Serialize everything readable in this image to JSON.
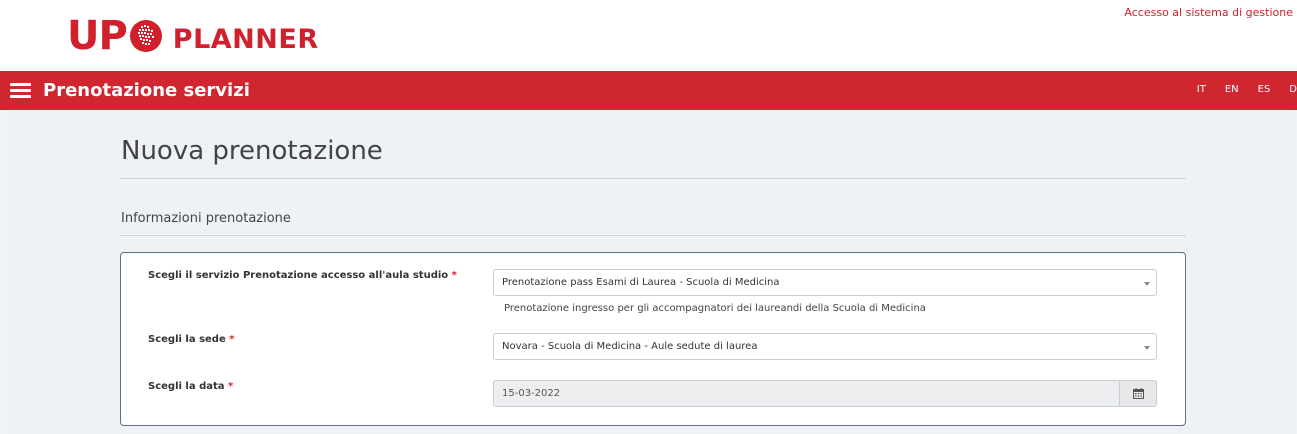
{
  "header": {
    "logo_up": "UP",
    "logo_planner": "PLANNER",
    "admin_link": "Accesso al sistema di gestione"
  },
  "navbar": {
    "title": "Prenotazione servizi",
    "languages": [
      "IT",
      "EN",
      "ES",
      "D"
    ]
  },
  "page": {
    "title": "Nuova prenotazione",
    "section_title": "Informazioni prenotazione"
  },
  "form": {
    "service": {
      "label": "Scegli il servizio Prenotazione accesso all'aula studio",
      "required_mark": "*",
      "value": "Prenotazione pass Esami di Laurea - Scuola di Medicina",
      "help": "Prenotazione ingresso per gli accompagnatori dei laureandi della Scuola di Medicina"
    },
    "site": {
      "label": "Scegli la sede",
      "required_mark": "*",
      "value": "Novara - Scuola di Medicina - Aule sedute di laurea"
    },
    "date": {
      "label": "Scegli la data",
      "required_mark": "*",
      "value": "15-03-2022"
    }
  },
  "colors": {
    "brand_red": "#d0262f",
    "background": "#eef2f6",
    "panel_border": "#5d6f86"
  },
  "icons": [
    "hamburger-menu-icon",
    "calendar-icon",
    "chevron-down-icon"
  ]
}
